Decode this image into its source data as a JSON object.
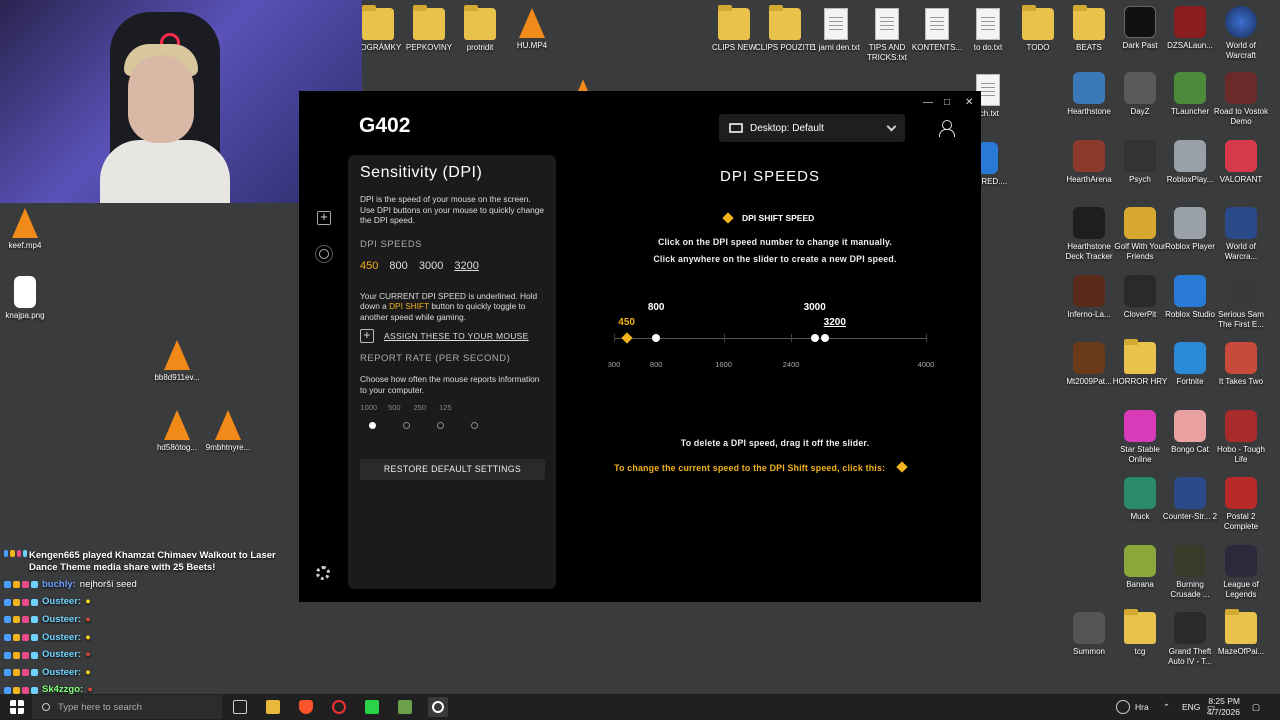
{
  "desktop_top": [
    "ROGRÁMKY",
    "PEPKOVINY",
    "protridit",
    "HU.MP4"
  ],
  "desktop_top_right": [
    "CLIPS NEW",
    "CLIPS POUZITE",
    "1 jarni den.txt",
    "TIPS AND TRICKS.txt",
    "KONTENTS...",
    "to do.txt",
    "TODO",
    "BEATS",
    "Dark Past",
    "DZSALaun...",
    "World of Warcraft"
  ],
  "desktop_left": [
    "keef.mp4",
    "knajpa.png",
    "bb8d911ev...",
    "hd58ótog...",
    "9mbhtnyre..."
  ],
  "partial_icons": [
    "rch.txt",
    "GORED...."
  ],
  "desktop_right": [
    [
      "Hearthstone",
      "DayZ",
      "TLauncher",
      "Road to Vostok Demo"
    ],
    [
      "HearthArena",
      "Psych",
      "RobloxPlay...",
      "VALORANT"
    ],
    [
      "Hearthstone Deck Tracker",
      "Golf With Your Friends",
      "Roblox Player",
      "World of Warcra..."
    ],
    [
      "Inferno-La...",
      "CloverPit",
      "Roblox Studio",
      "Serious Sam The First E..."
    ],
    [
      "Mt2009Pat...",
      "HORROR HRY",
      "Fortnite",
      "It Takes Two"
    ],
    [
      "",
      "Star Stable Online",
      "Bongo Cat",
      "Hobo - Tough Life"
    ],
    [
      "",
      "Muck",
      "Counter-Str... 2",
      "Postal 2 Complete"
    ],
    [
      "",
      "Banana",
      "Burning Crusade ...",
      "League of Legends"
    ],
    [
      "Summon",
      "tcg",
      "Grand Theft Auto IV - T...",
      "MazeOfPai..."
    ]
  ],
  "ghub": {
    "product": "G402",
    "profile": "Desktop: Default",
    "controls": {
      "minimize": "—",
      "maximize": "□",
      "close": "✕"
    },
    "panel": {
      "title": "Sensitivity (DPI)",
      "desc": "DPI is the speed of your mouse on the screen. Use DPI buttons on your mouse to quickly change the DPI speed.",
      "speeds_label": "DPI SPEEDS",
      "speeds": [
        "450",
        "800",
        "3000",
        "3200"
      ],
      "note_1": "Your CURRENT DPI SPEED is underlined. Hold down a ",
      "note_hl": "DPI SHIFT",
      "note_2": " button to quickly toggle to another speed while gaming.",
      "assign": "ASSIGN THESE TO YOUR MOUSE",
      "report_label": "REPORT RATE (PER SECOND)",
      "report_desc": "Choose how often the mouse reports information to your computer.",
      "rates": [
        "1000",
        "500",
        "250",
        "125"
      ],
      "selected_rate": "1000",
      "restore": "RESTORE DEFAULT SETTINGS"
    },
    "main": {
      "title": "DPI SPEEDS",
      "shift_legend": "DPI SHIFT SPEED",
      "hint1": "Click on the DPI speed number to change it manually.",
      "hint2": "Click anywhere on the slider to create a new DPI speed.",
      "hint3": "To delete a DPI speed, drag it off the slider.",
      "hint4": "To change the current speed to the DPI Shift speed, click this:",
      "slider": {
        "min": 300,
        "max": 4000,
        "ticks": [
          "300",
          "800",
          "1600",
          "2400",
          "4000"
        ],
        "points": [
          {
            "value": 450,
            "label": "450",
            "shift": true
          },
          {
            "value": 800,
            "label": "800"
          },
          {
            "value": 2680,
            "label": "3000"
          },
          {
            "value": 2800,
            "label": "3200",
            "current": true
          }
        ]
      }
    }
  },
  "chat": [
    {
      "user": "Kengen665",
      "text": "Kengen665 played Khamzat Chimaev Walkout to Laser Dance Theme media share with 25 Beets!"
    },
    {
      "user": "buchly:",
      "text": "nejhorší seed",
      "color": "#6aa0ff"
    },
    {
      "user": "Ousteer:",
      "text": "",
      "color": "#6fd3ff"
    },
    {
      "user": "Ousteer:",
      "text": "",
      "color": "#6fd3ff"
    },
    {
      "user": "Ousteer:",
      "text": "",
      "color": "#6fd3ff"
    },
    {
      "user": "Ousteer:",
      "text": "",
      "color": "#6fd3ff"
    },
    {
      "user": "Ousteer:",
      "text": "",
      "color": "#6fd3ff"
    },
    {
      "user": "Sk4zzgo:",
      "text": "",
      "color": "#7dff7a"
    }
  ],
  "taskbar": {
    "search_placeholder": "Type here to search",
    "weather": "Hra",
    "lang": "ENG",
    "time": "8:25 PM",
    "date": "4/7/2026"
  },
  "colors": {
    "accent": "#f3b31b",
    "window_bg": "#000000",
    "panel_bg": "#1b1b1b"
  }
}
